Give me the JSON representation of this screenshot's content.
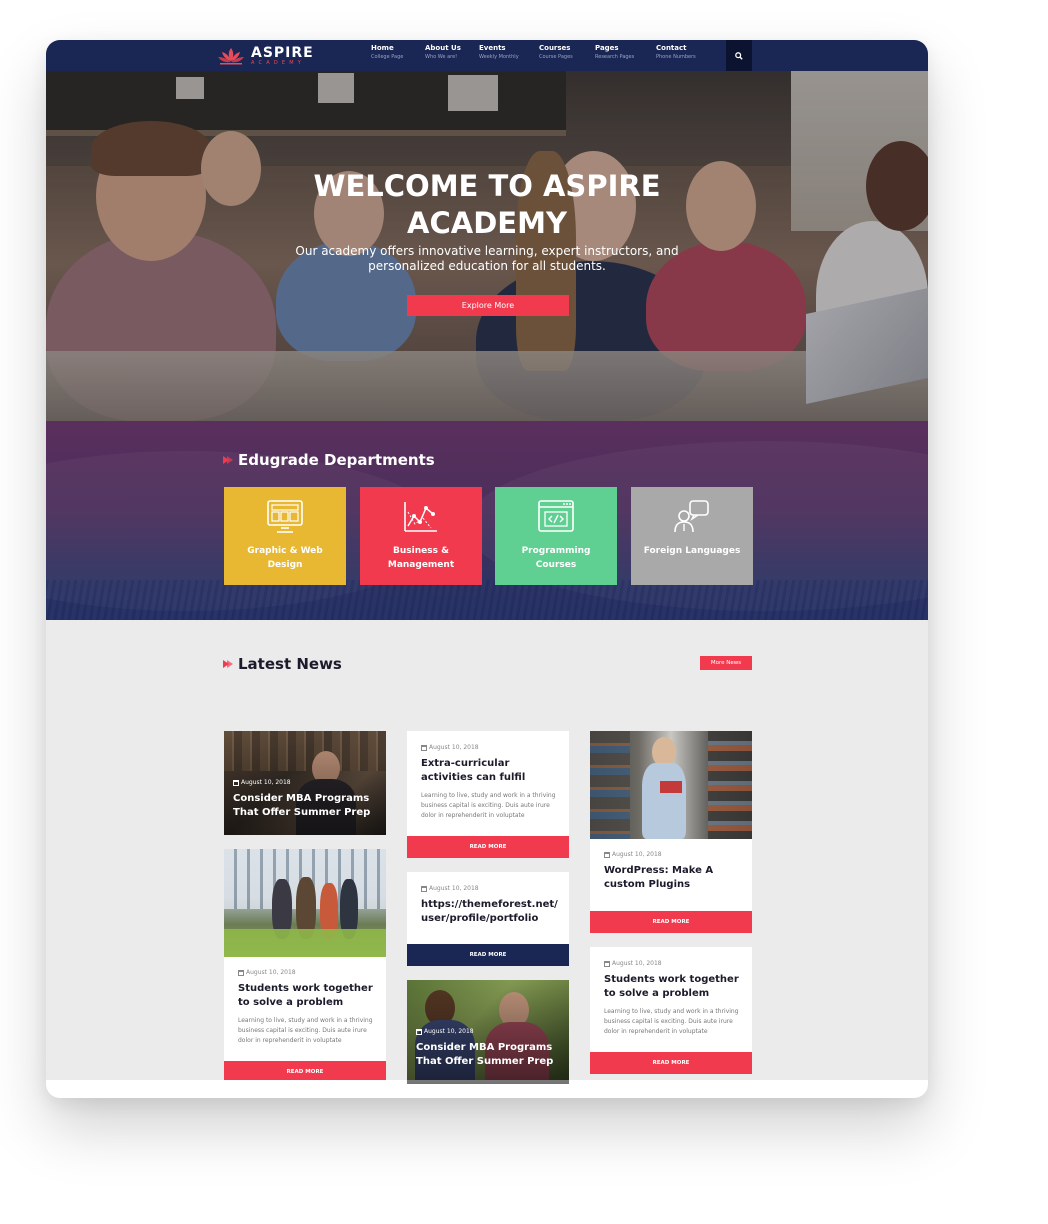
{
  "brand": {
    "name": "ASPIRE",
    "tagline": "ACADEMY",
    "accent": "#f23a4e",
    "navy": "#1a2653"
  },
  "nav": {
    "items": [
      {
        "label": "Home",
        "sub": "College Page"
      },
      {
        "label": "About Us",
        "sub": "Who We are!"
      },
      {
        "label": "Events",
        "sub": "Weekly Monthly"
      },
      {
        "label": "Courses",
        "sub": "Course Pages"
      },
      {
        "label": "Pages",
        "sub": "Research Pages"
      },
      {
        "label": "Contact",
        "sub": "Phone Numbers"
      }
    ],
    "search_icon": "search-icon"
  },
  "hero": {
    "title_line1": "WELCOME TO ASPIRE",
    "title_line2": "ACADEMY",
    "description": "Our academy offers innovative learning, expert instructors, and personalized education for all students.",
    "cta": "Explore More"
  },
  "departments": {
    "heading": "Edugrade Departments",
    "items": [
      {
        "label": "Graphic & Web Design",
        "icon": "monitor-layout-icon",
        "color": "#e8b832"
      },
      {
        "label": "Business & Management",
        "icon": "chart-graph-icon",
        "color": "#f23a4e"
      },
      {
        "label": "Programming Courses",
        "icon": "code-window-icon",
        "color": "#5fcf92"
      },
      {
        "label": "Foreign Languages",
        "icon": "speech-person-icon",
        "color": "#a9a9a9"
      }
    ]
  },
  "news": {
    "heading": "Latest News",
    "more_label": "More News",
    "read_more": "READ MORE",
    "cards": [
      {
        "date": "August 10, 2018",
        "title": "Consider MBA Programs That Offer Summer Prep"
      },
      {
        "date": "August 10, 2018",
        "title": "Students work together to solve a problem",
        "excerpt": "Learning to live, study and work in a thriving business capital is exciting. Duis aute irure dolor in reprehenderit in voluptate"
      },
      {
        "date": "August 10, 2018",
        "title": "Extra-curricular activities can fulfil",
        "excerpt": "Learning to live, study and work in a thriving business capital is exciting. Duis aute irure dolor in reprehenderit in voluptate"
      },
      {
        "date": "August 10, 2018",
        "title": "https://themeforest.net/user/profile/portfolio"
      },
      {
        "date": "August 10, 2018",
        "title": "Consider MBA Programs That Offer Summer Prep"
      },
      {
        "date": "August 10, 2018",
        "title": "WordPress: Make A custom Plugins"
      },
      {
        "date": "August 10, 2018",
        "title": "Students work together to solve a problem",
        "excerpt": "Learning to live, study and work in a thriving business capital is exciting. Duis aute irure dolor in reprehenderit in voluptate"
      }
    ]
  }
}
